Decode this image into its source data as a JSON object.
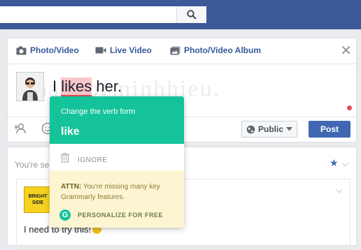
{
  "composer": {
    "tabs": [
      {
        "label": "Photo/Video",
        "icon": "camera-icon"
      },
      {
        "label": "Live Video",
        "icon": "video-camera-icon"
      },
      {
        "label": "Photo/Video Album",
        "icon": "album-icon"
      }
    ],
    "watermark": "hoangocminhhieu.",
    "text_before": "I ",
    "text_highlight": "likes",
    "text_after": " her.",
    "privacy_label": "Public",
    "post_label": "Post"
  },
  "grammarly": {
    "title": "Change the verb form",
    "suggestion": "like",
    "ignore_label": "IGNORE",
    "attn_bold": "ATTN:",
    "attn_text": "You're missing many key Grammarly features.",
    "personalize_label": "PERSONALIZE FOR FREE",
    "logo_letter": "G"
  },
  "feed": {
    "section_label": "You're se",
    "page_logo_text": "BRIGHT SIDE",
    "post_text": "I need to try this!"
  },
  "colors": {
    "facebook_blue": "#3b5998",
    "grammarly_green": "#15c39a",
    "attn_background": "#fdf5d2",
    "error_red": "#e24d5b"
  }
}
